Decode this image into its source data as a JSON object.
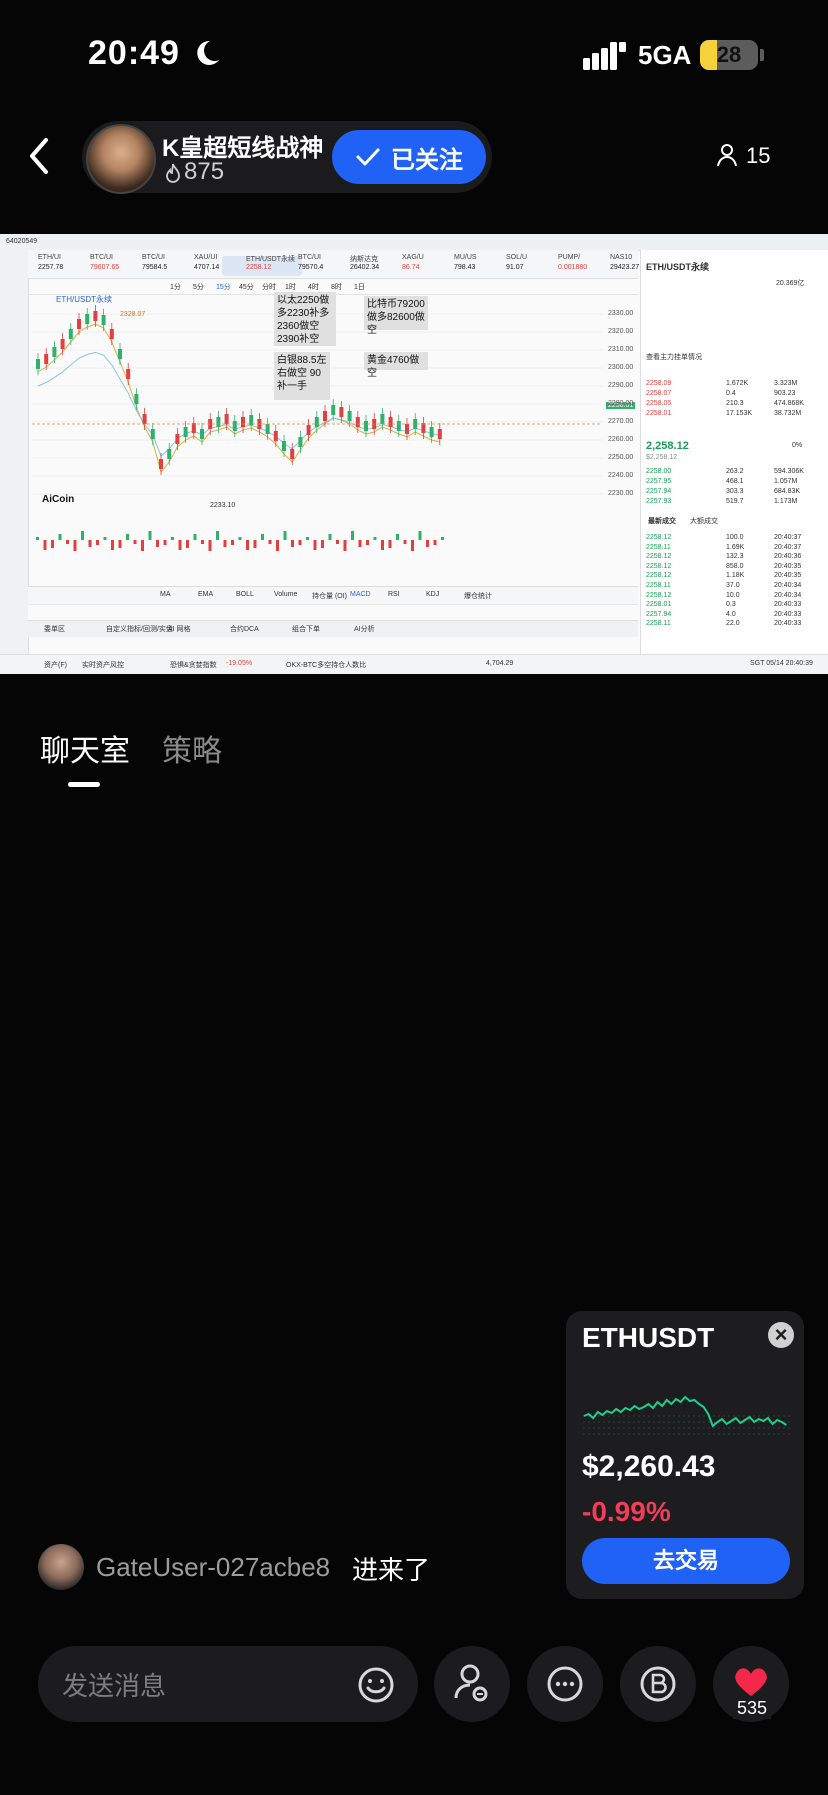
{
  "status_bar": {
    "time": "20:49",
    "network": "5GA",
    "battery": "28"
  },
  "header": {
    "host_name": "K皇超短线战神",
    "host_heat": "875",
    "follow_label": "已关注",
    "viewers": "15"
  },
  "screen": {
    "window_id": "64020549",
    "top_tickers": [
      {
        "sym": "ETH/UI",
        "price": "2257.78"
      },
      {
        "sym": "BTC/UI",
        "price": "79607.65"
      },
      {
        "sym": "BTC/UI",
        "price": "79584.5"
      },
      {
        "sym": "XAU/UI",
        "price": "4707.14"
      },
      {
        "sym": "ETH/USDT永续",
        "price": "2258.12"
      },
      {
        "sym": "BTC/UI",
        "price": "79570.4"
      },
      {
        "sym": "纳斯达克",
        "price": "26402.34"
      },
      {
        "sym": "XAG/U",
        "price": "86.74"
      },
      {
        "sym": "MU/US",
        "price": "798.43"
      },
      {
        "sym": "SOL/U",
        "price": "91.07"
      },
      {
        "sym": "PUMP/",
        "price": "0.001880"
      },
      {
        "sym": "NAS10",
        "price": "29423.27"
      }
    ],
    "timeframes": [
      "1分",
      "5分",
      "15分",
      "45分",
      "分时",
      "1时",
      "4时",
      "8时",
      "1日"
    ],
    "chart_title": "ETH/USDT永续",
    "price_ticks": [
      "2330.00",
      "2320.00",
      "2310.00",
      "2300.00",
      "2290.00",
      "2280.00",
      "2270.00",
      "2260.00",
      "2250.00",
      "2240.00",
      "2230.00"
    ],
    "high_label": "2328.07",
    "low_label": "2233.10",
    "last_price_tag": "2258.01",
    "annotations": {
      "eth": "以太2250做多2230补多 2360做空 2390补空",
      "btc": "比特币79200做多82600做空",
      "silver": "白银88.5左右做空 90补一手",
      "gold": "黄金4760做空"
    },
    "indicators": [
      "MA",
      "EMA",
      "BOLL",
      "Volume",
      "持仓量 (OI)",
      "MACD",
      "RSI",
      "KDJ",
      "爆仓统计"
    ],
    "bottom_tabs": [
      "委单区",
      "自定义指标/回测/实盘",
      "AI 网格",
      "合约DCA",
      "组合下单",
      "AI分析"
    ],
    "logo": "AiCoin",
    "right_panel": {
      "title": "ETH/USDT永续",
      "volume": "20.369亿",
      "big_order": "查看主力挂单情况",
      "price": "2,258.12",
      "sub_price": "$2,258.12",
      "pct": "0%",
      "asks": [
        {
          "p": "2258.09",
          "q": "1.672K",
          "t": "3.323M"
        },
        {
          "p": "2258.07",
          "q": "0.4",
          "t": "903.23"
        },
        {
          "p": "2258.05",
          "q": "210.3",
          "t": "474.868K"
        },
        {
          "p": "2258.01",
          "q": "17.153K",
          "t": "38.732M"
        }
      ],
      "bids": [
        {
          "p": "2258.00",
          "q": "263.2",
          "t": "594.306K"
        },
        {
          "p": "2257.95",
          "q": "468.1",
          "t": "1.057M"
        },
        {
          "p": "2257.94",
          "q": "303.3",
          "t": "684.83K"
        },
        {
          "p": "2257.93",
          "q": "519.7",
          "t": "1.173M"
        }
      ],
      "trades_tab": "最新成交",
      "trades_tab2": "大额成交",
      "trades": [
        {
          "p": "2258.12",
          "q": "100.0",
          "t": "20:40:37"
        },
        {
          "p": "2258.11",
          "q": "1.69K",
          "t": "20:40:37"
        },
        {
          "p": "2258.12",
          "q": "132.3",
          "t": "20:40:36"
        },
        {
          "p": "2258.12",
          "q": "858.0",
          "t": "20:40:35"
        },
        {
          "p": "2258.12",
          "q": "1.18K",
          "t": "20:40:35"
        },
        {
          "p": "2258.11",
          "q": "37.0",
          "t": "20:40:34"
        },
        {
          "p": "2258.12",
          "q": "10.0",
          "t": "20:40:34"
        },
        {
          "p": "2258.01",
          "q": "0.3",
          "t": "20:40:33"
        },
        {
          "p": "2257.94",
          "q": "4.0",
          "t": "20:40:33"
        },
        {
          "p": "2258.11",
          "q": "22.0",
          "t": "20:40:33"
        }
      ]
    },
    "footer": {
      "assets": "资产(F)",
      "risk": "实时资产风控",
      "fear": "恐惧&贪婪指数",
      "fear_val": "-19.05%",
      "okx": "OKX-BTC多空持仓人数比",
      "eth_price": "4,704.29",
      "time": "SGT 05/14 20:40:39"
    }
  },
  "tabs": {
    "chat": "聊天室",
    "strategy": "策略"
  },
  "card": {
    "symbol": "ETHUSDT",
    "price": "$2,260.43",
    "change": "-0.99%",
    "button": "去交易",
    "accent": "#1fcf8e",
    "spark": [
      52,
      50,
      54,
      48,
      51,
      47,
      49,
      45,
      48,
      44,
      46,
      42,
      45,
      43,
      40,
      44,
      38,
      42,
      36,
      40,
      35,
      38,
      33,
      37,
      36,
      40,
      43,
      50,
      62,
      58,
      55,
      60,
      57,
      54,
      59,
      56,
      53,
      58,
      55,
      57,
      54,
      60,
      56,
      58,
      61
    ]
  },
  "chat": {
    "user": "GateUser-027acbe8",
    "message": "进来了"
  },
  "bottom": {
    "placeholder": "发送消息",
    "likes": "535"
  }
}
